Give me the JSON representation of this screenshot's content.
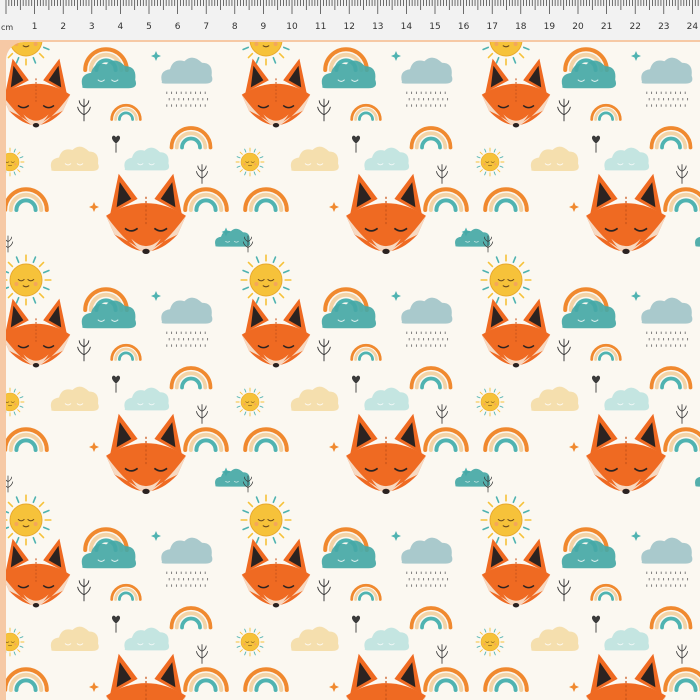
{
  "ruler": {
    "unit": "cm",
    "numbers": [
      "1",
      "2",
      "3",
      "4",
      "5",
      "6",
      "7",
      "8",
      "9",
      "10",
      "11",
      "12",
      "13",
      "14",
      "15",
      "16",
      "17",
      "18",
      "19",
      "20",
      "21",
      "22",
      "23",
      "24"
    ]
  },
  "fabric": {
    "motifs": [
      "fox-icon",
      "sun-icon",
      "rainbow-icon",
      "cloud-icon",
      "rain-cloud-icon",
      "plant-sprig-icon",
      "star-icon",
      "heart-icon"
    ],
    "colors": {
      "background": "#fbf8f1",
      "fox_orange": "#ef6a22",
      "fox_dark": "#2b2321",
      "sun_yellow": "#f6c23a",
      "rainbow_orange": "#f0892f",
      "rainbow_teal": "#4fb3b1",
      "cloud_teal": "#45a8a6",
      "cloud_pale": "#bfe3df",
      "rainbow_sand": "#f3d3a6"
    }
  }
}
